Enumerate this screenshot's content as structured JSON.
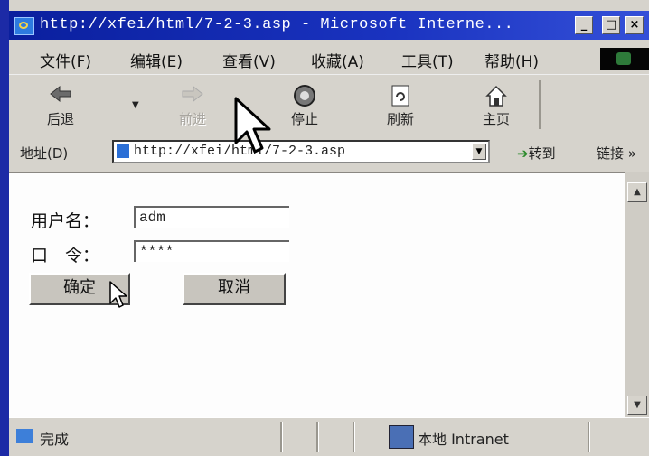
{
  "window": {
    "title": "http://xfei/html/7-2-3.asp - Microsoft Interne..."
  },
  "window_controls": [
    "_",
    "□",
    "×"
  ],
  "menu": {
    "items": [
      "文件(F)",
      "编辑(E)",
      "查看(V)",
      "收藏(A)",
      "工具(T)",
      "帮助(H)"
    ]
  },
  "toolbar": {
    "back": "后退",
    "forward": "前进",
    "stop": "停止",
    "refresh": "刷新",
    "home": "主页"
  },
  "address": {
    "label": "地址(D)",
    "url": "http://xfei/html/7-2-3.asp",
    "go": "转到",
    "links": "链接 »"
  },
  "form": {
    "username_label": "用户名：",
    "username_value": "adm",
    "password_label": "口　令：",
    "password_value": "****",
    "ok_button": "确定",
    "cancel_button": "取消"
  },
  "status": {
    "text": "完成",
    "zone": "本地 Intranet"
  },
  "colors": {
    "titlebar": "#0a1f9e",
    "chrome": "#d6d3cc",
    "desktop": "#1c2aa6"
  }
}
